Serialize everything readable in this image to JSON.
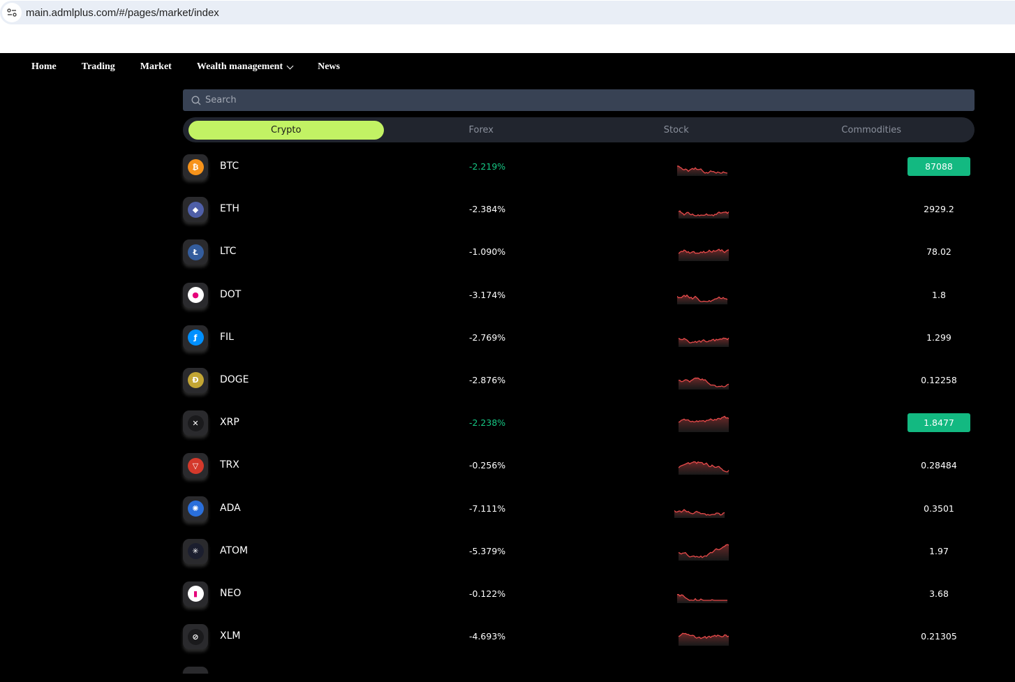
{
  "browser": {
    "url": "main.admlplus.com/#/pages/market/index"
  },
  "nav": {
    "items": [
      "Home",
      "Trading",
      "Market",
      "Wealth management",
      "News"
    ]
  },
  "search": {
    "placeholder": "Search"
  },
  "tabs": [
    {
      "label": "Crypto",
      "active": true
    },
    {
      "label": "Forex"
    },
    {
      "label": "Stock"
    },
    {
      "label": "Commodities"
    }
  ],
  "colors": {
    "accent": "#c2f264",
    "up": "#13b981",
    "spark": "#e84a4a"
  },
  "rows": [
    {
      "symbol": "BTC",
      "change": "-2.219%",
      "price": "87088",
      "highlight": true,
      "coin_color": "#f7931a",
      "glyph": "₿"
    },
    {
      "symbol": "ETH",
      "change": "-2.384%",
      "price": "2929.2",
      "coin_color": "#4f5fa8",
      "glyph": "◆"
    },
    {
      "symbol": "LTC",
      "change": "-1.090%",
      "price": "78.02",
      "coin_color": "#345d9d",
      "glyph": "Ł"
    },
    {
      "symbol": "DOT",
      "change": "-3.174%",
      "price": "1.8",
      "coin_color": "#ffffff",
      "glyph": "●"
    },
    {
      "symbol": "FIL",
      "change": "-2.769%",
      "price": "1.299",
      "coin_color": "#0090ff",
      "glyph": "ƒ"
    },
    {
      "symbol": "DOGE",
      "change": "-2.876%",
      "price": "0.12258",
      "coin_color": "#c3a634",
      "glyph": "Ð"
    },
    {
      "symbol": "XRP",
      "change": "-2.238%",
      "price": "1.8477",
      "highlight": true,
      "coin_color": "#1a1a1c",
      "glyph": "✕"
    },
    {
      "symbol": "TRX",
      "change": "-0.256%",
      "price": "0.28484",
      "coin_color": "#d4392b",
      "glyph": "▽"
    },
    {
      "symbol": "ADA",
      "change": "-7.111%",
      "price": "0.3501",
      "coin_color": "#2a6fdb",
      "glyph": "✺"
    },
    {
      "symbol": "ATOM",
      "change": "-5.379%",
      "price": "1.97",
      "coin_color": "#1b1e2e",
      "glyph": "✳"
    },
    {
      "symbol": "NEO",
      "change": "-0.122%",
      "price": "3.68",
      "coin_color": "#ffffff",
      "glyph": "▮"
    },
    {
      "symbol": "XLM",
      "change": "-4.693%",
      "price": "0.21305",
      "coin_color": "#1a1a1c",
      "glyph": "⊘"
    }
  ]
}
